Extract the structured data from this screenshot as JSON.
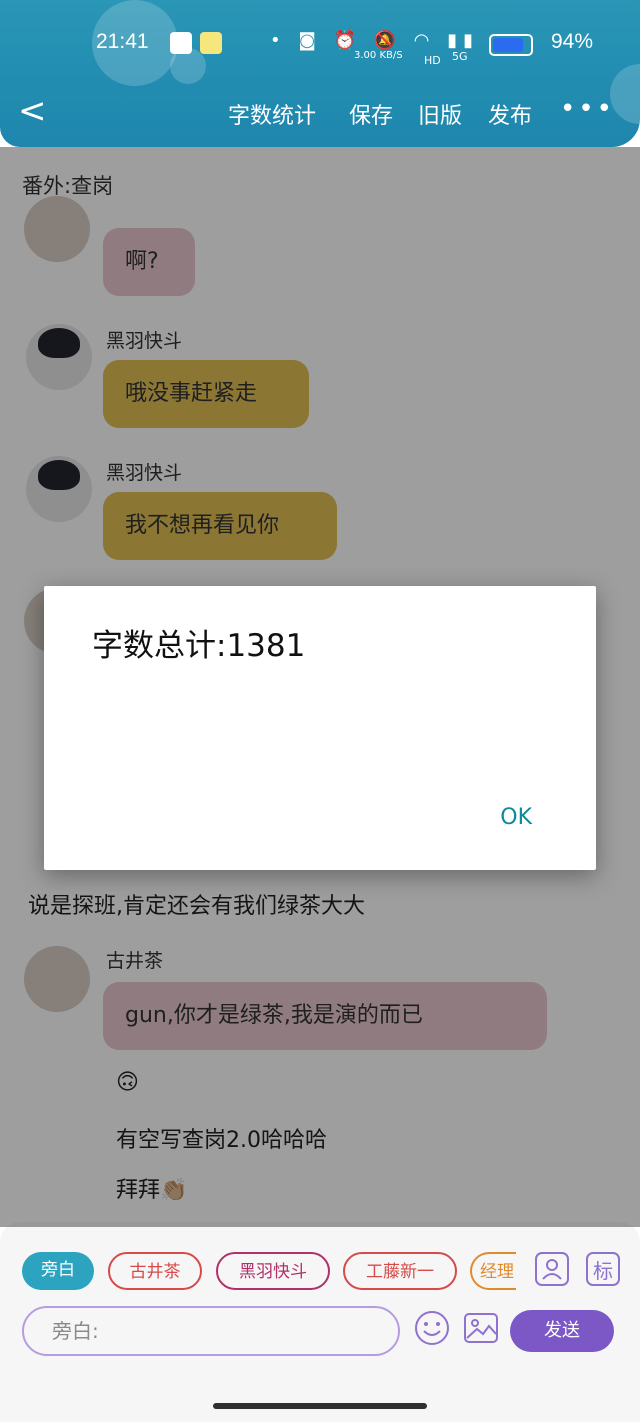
{
  "status_bar": {
    "time": "21:41",
    "speed": "3.00 KB/S",
    "network": "5G",
    "hd": "HD",
    "battery_percent": "94%",
    "battery_level": 0.94
  },
  "toolbar": {
    "back_label": "<",
    "word_count_label": "字数统计",
    "save_label": "保存",
    "old_version_label": "旧版",
    "publish_label": "发布",
    "more_label": "•••"
  },
  "story": {
    "title": "番外:查岗"
  },
  "messages": [
    {
      "speaker": "",
      "text": "啊?",
      "style": "pink"
    },
    {
      "speaker": "黑羽快斗",
      "text": "哦没事赶紧走",
      "style": "yellow"
    },
    {
      "speaker": "黑羽快斗",
      "text": "我不想再看见你",
      "style": "yellow"
    },
    {
      "speaker": "",
      "text": "说是探班,肯定还会有我们绿茶大大",
      "style": "plain"
    },
    {
      "speaker": "古井茶",
      "text": "gun,你才是绿茶,我是演的而已",
      "style": "pink"
    }
  ],
  "narration": [
    {
      "text": "🙃"
    },
    {
      "text": "有空写查岗2.0哈哈哈"
    },
    {
      "text": "拜拜👏🏼"
    }
  ],
  "dialog": {
    "message": "字数总计:1381",
    "ok_label": "OK"
  },
  "chips": [
    "旁白",
    "古井茶",
    "黑羽快斗",
    "工藤新一",
    "经理"
  ],
  "chip_colors": [
    "#2ca3bf",
    "#d64a4a",
    "#b0306a",
    "#d64a4a",
    "#e08a2e"
  ],
  "icons": {
    "person": "person-icon",
    "tag": "标"
  },
  "input": {
    "placeholder": "旁白:"
  },
  "send_label": "发送"
}
